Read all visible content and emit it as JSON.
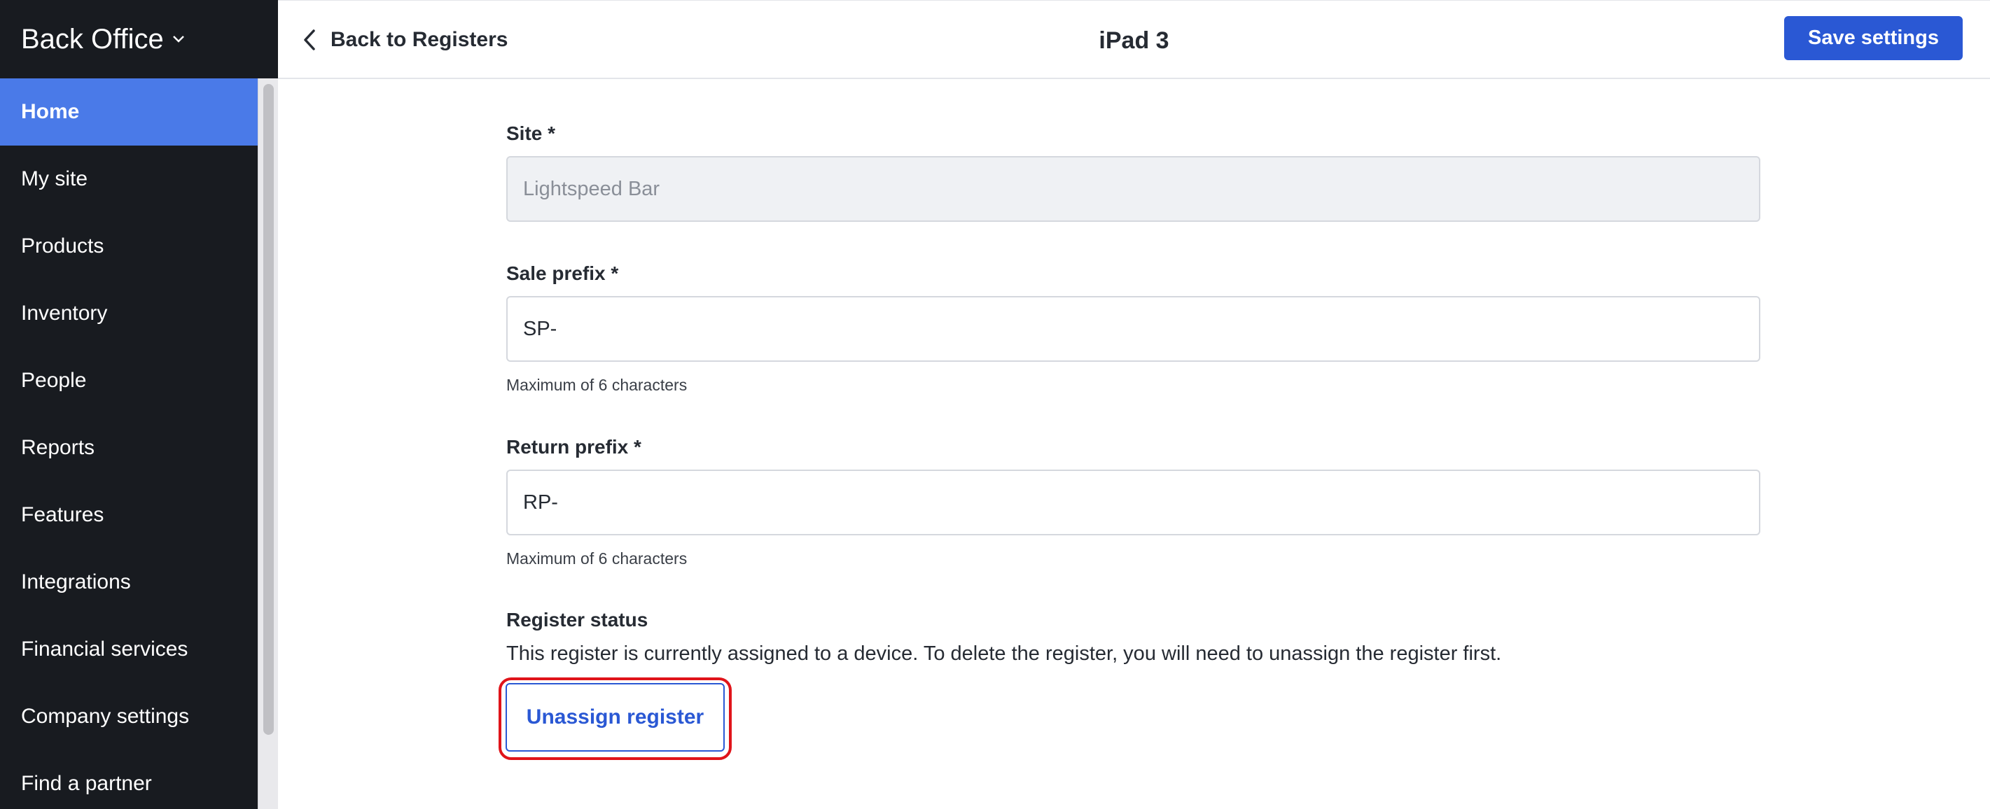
{
  "sidebar": {
    "brand": "Back Office",
    "items": [
      {
        "label": "Home",
        "active": true
      },
      {
        "label": "My site"
      },
      {
        "label": "Products"
      },
      {
        "label": "Inventory"
      },
      {
        "label": "People"
      },
      {
        "label": "Reports"
      },
      {
        "label": "Features"
      },
      {
        "label": "Integrations"
      },
      {
        "label": "Financial services"
      },
      {
        "label": "Company settings"
      },
      {
        "label": "Find a partner"
      }
    ]
  },
  "header": {
    "back_label": "Back to Registers",
    "title": "iPad 3",
    "save_label": "Save settings"
  },
  "form": {
    "site": {
      "label": "Site *",
      "value": "Lightspeed Bar"
    },
    "sale_prefix": {
      "label": "Sale prefix *",
      "value": "SP-",
      "hint": "Maximum of 6 characters"
    },
    "return_prefix": {
      "label": "Return prefix *",
      "value": "RP-",
      "hint": "Maximum of 6 characters"
    },
    "register_status": {
      "label": "Register status",
      "description": "This register is currently assigned to a device. To delete the register, you will need to unassign the register first.",
      "button_label": "Unassign register"
    }
  },
  "colors": {
    "sidebar_bg": "#181b20",
    "active_nav": "#4a7ae8",
    "primary": "#2a58d4",
    "highlight": "#e0141a"
  }
}
